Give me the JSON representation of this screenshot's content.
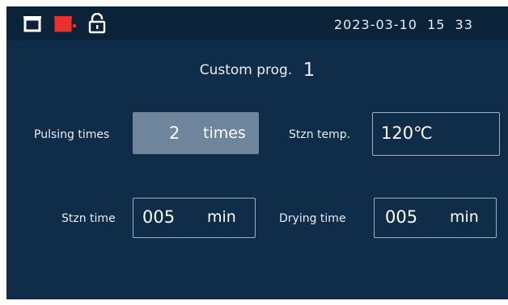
{
  "status_bar": {
    "icons": [
      "basket-icon",
      "basket-heating-icon",
      "unlocked-padlock-icon"
    ],
    "date": "2023-03-10",
    "hour": "15",
    "minute": "33"
  },
  "program": {
    "title": "Custom prog.",
    "number": "1"
  },
  "params": {
    "pulsing_times": {
      "label": "Pulsing times",
      "value": "2",
      "unit": "times"
    },
    "stzn_temp": {
      "label": "Stzn temp.",
      "value": "120℃"
    },
    "stzn_time": {
      "label": "Stzn time",
      "value": "005",
      "unit": "min"
    },
    "drying_time": {
      "label": "Drying time",
      "value": "005",
      "unit": "min"
    }
  },
  "colors": {
    "background": "#0f2d48",
    "topbar": "#0b2339",
    "selected_field": "#6f859b",
    "heating_icon": "#e8312a"
  }
}
